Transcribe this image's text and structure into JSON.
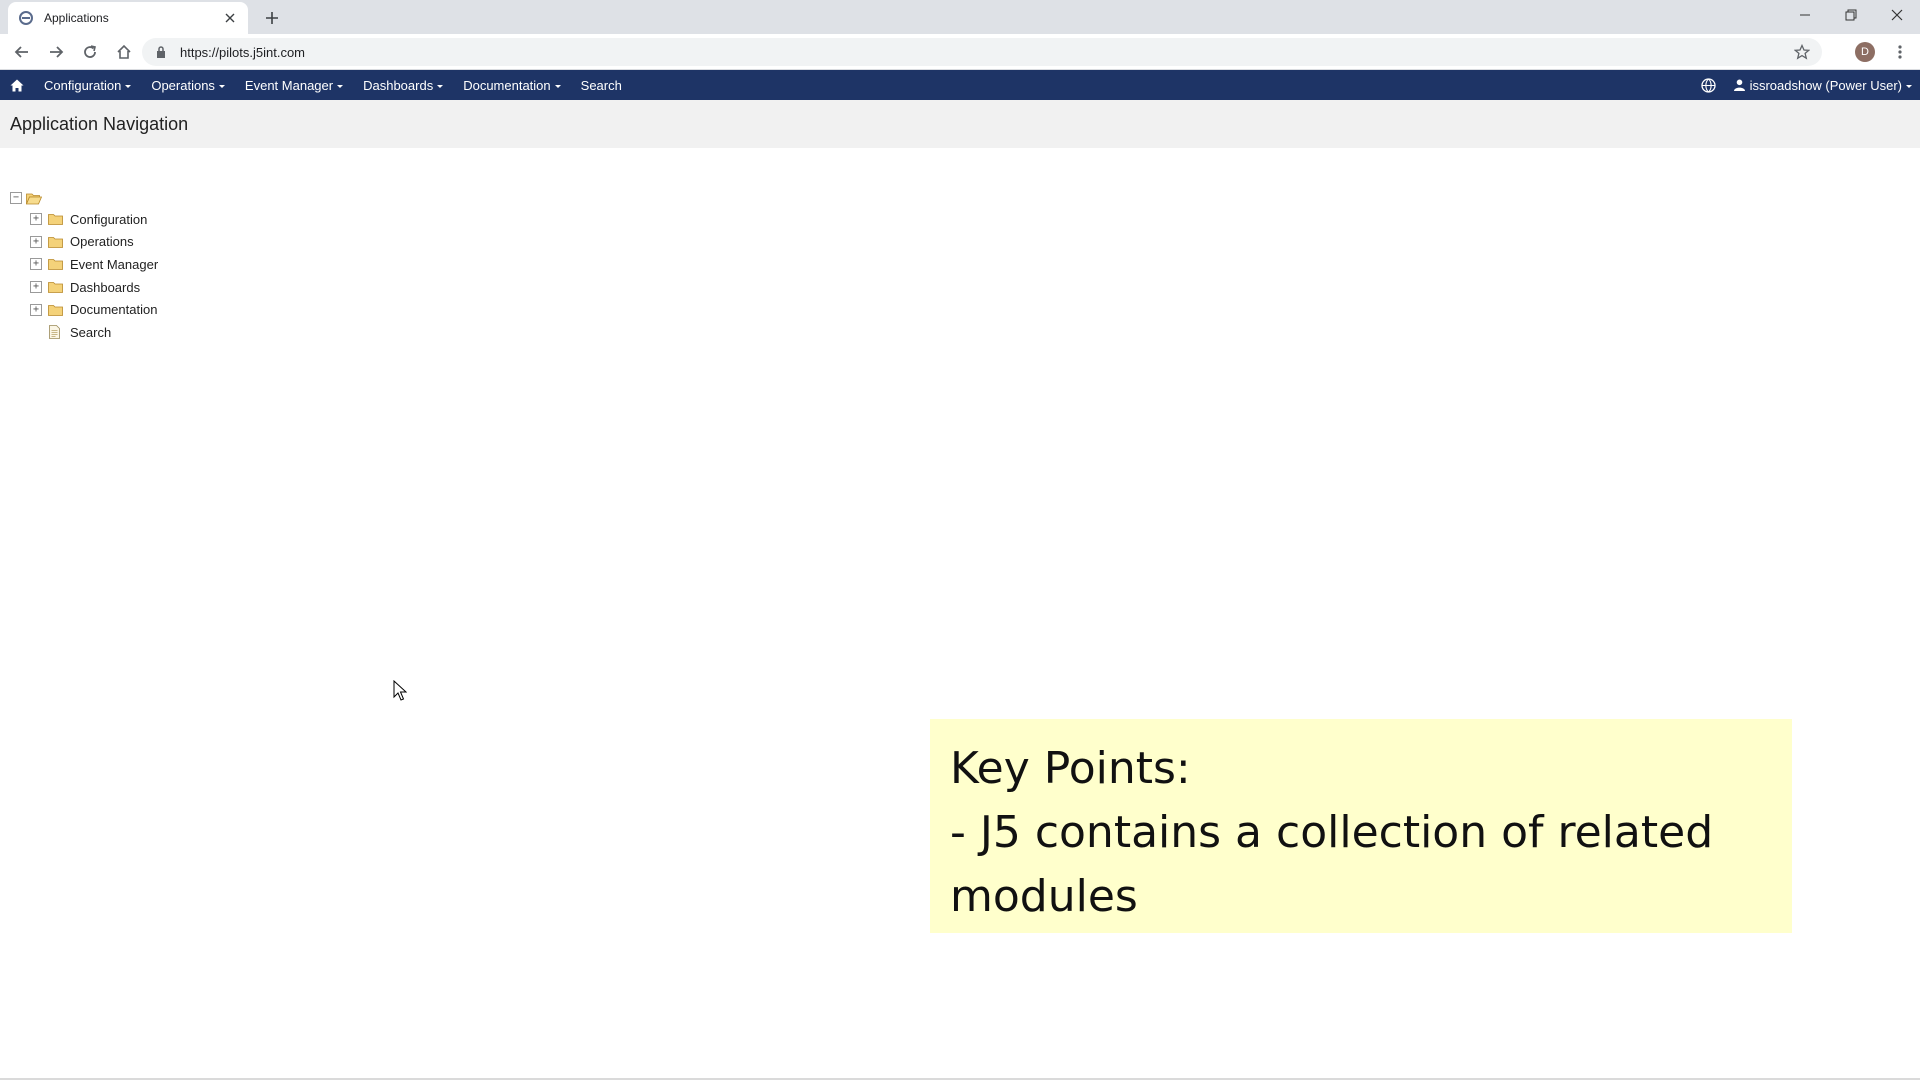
{
  "browser": {
    "tab_title": "Applications",
    "url": "https://pilots.j5int.com",
    "profile_initial": "D"
  },
  "appnav": {
    "menu": [
      {
        "label": "Configuration"
      },
      {
        "label": "Operations"
      },
      {
        "label": "Event Manager"
      },
      {
        "label": "Dashboards"
      },
      {
        "label": "Documentation"
      },
      {
        "label": "Search"
      }
    ],
    "user": "issroadshow (Power User)"
  },
  "page": {
    "title": "Application Navigation"
  },
  "tree": {
    "root_toggle": "−",
    "nodes": [
      {
        "label": "Configuration",
        "toggle": "+",
        "icon": "folder-icon"
      },
      {
        "label": "Operations",
        "toggle": "+",
        "icon": "folder-icon"
      },
      {
        "label": "Event Manager",
        "toggle": "+",
        "icon": "folder-icon"
      },
      {
        "label": "Dashboards",
        "toggle": "+",
        "icon": "folder-icon"
      },
      {
        "label": "Documentation",
        "toggle": "+",
        "icon": "folder-icon"
      },
      {
        "label": "Search",
        "toggle": "",
        "icon": "page-icon"
      }
    ]
  },
  "note": {
    "lines": [
      "Key Points:",
      "- J5 contains a collection of related",
      "modules"
    ]
  },
  "colors": {
    "navbar": "#1e3466",
    "note_bg": "#ffffcc",
    "header_bg": "#f1f1f1",
    "folder": "#e8b84a"
  }
}
